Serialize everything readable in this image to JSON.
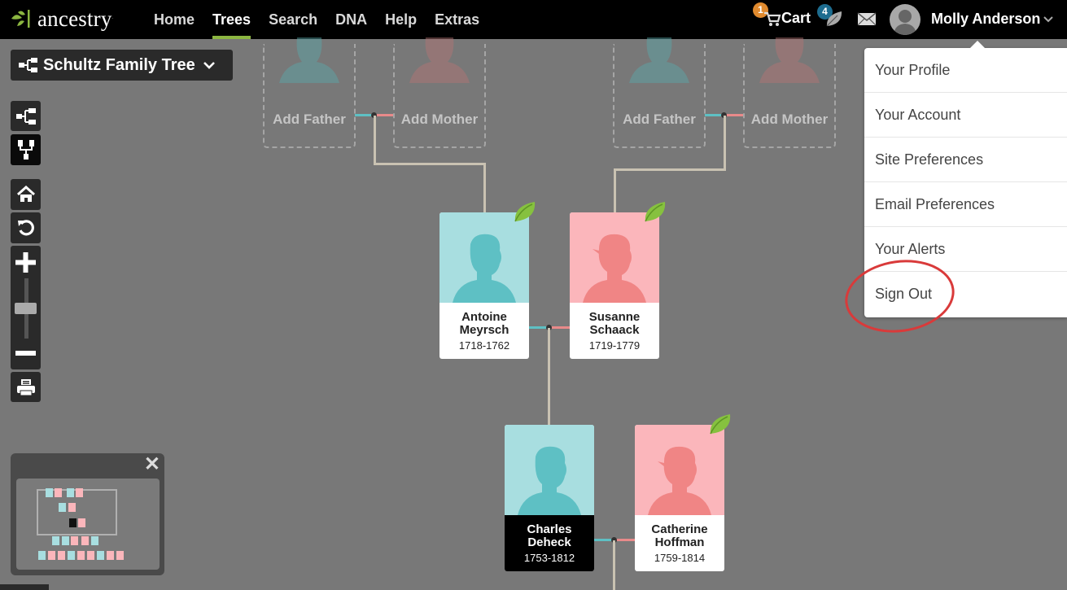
{
  "header": {
    "logo_text": "ancestry",
    "nav": [
      {
        "label": "Home",
        "active": false
      },
      {
        "label": "Trees",
        "active": true
      },
      {
        "label": "Search",
        "active": false
      },
      {
        "label": "DNA",
        "active": false
      },
      {
        "label": "Help",
        "active": false
      },
      {
        "label": "Extras",
        "active": false
      }
    ],
    "cart_label": "Cart",
    "cart_count": "1",
    "hints_count": "4",
    "user_name": "Molly Anderson"
  },
  "tree_selector": {
    "label": "Schultz Family Tree"
  },
  "tools": {
    "pedigree_view": "pedigree-view-icon",
    "family_view": "family-view-icon",
    "home": "home-icon",
    "reset": "reset-icon",
    "zoom_in": "plus-icon",
    "zoom_out": "minus-icon",
    "print": "print-icon",
    "zoom_level": 0.43
  },
  "placeholders": [
    {
      "father_label": "Add Father",
      "mother_label": "Add Mother"
    },
    {
      "father_label": "Add Father",
      "mother_label": "Add Mother"
    }
  ],
  "people": [
    {
      "first": "Antoine",
      "last": "Meyrsch",
      "dates": "1718-1762",
      "gender": "male",
      "hint": true
    },
    {
      "first": "Susanne",
      "last": "Schaack",
      "dates": "1719-1779",
      "gender": "female",
      "hint": true
    },
    {
      "first": "Charles",
      "last": "Deheck",
      "dates": "1753-1812",
      "gender": "male",
      "hint": false,
      "selected": true
    },
    {
      "first": "Catherine",
      "last": "Hoffman",
      "dates": "1759-1814",
      "gender": "female",
      "hint": true
    }
  ],
  "account_menu": {
    "items": [
      "Your Profile",
      "Your Account",
      "Site Preferences",
      "Email Preferences",
      "Your Alerts",
      "Sign Out"
    ],
    "highlighted": "Sign Out"
  },
  "colors": {
    "accent_green": "#8cb641",
    "male": "#a8dee0",
    "female": "#fbb6bb",
    "cart_badge": "#e08a2e",
    "hints_badge": "#1d6c8f",
    "annotation": "#d93a3a"
  }
}
